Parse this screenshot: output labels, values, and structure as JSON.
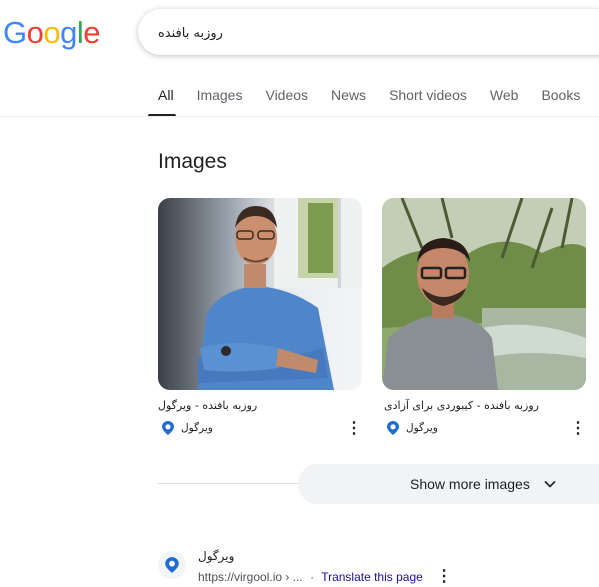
{
  "logo": {
    "letters": [
      "G",
      "o",
      "o",
      "g",
      "l",
      "e"
    ],
    "colors": [
      "#4285F4",
      "#EA4335",
      "#FBBC05",
      "#4285F4",
      "#34A853",
      "#EA4335"
    ]
  },
  "search": {
    "query": "روزبه بافنده"
  },
  "tabs": [
    {
      "label": "All",
      "active": true
    },
    {
      "label": "Images"
    },
    {
      "label": "Videos"
    },
    {
      "label": "News"
    },
    {
      "label": "Short videos"
    },
    {
      "label": "Web"
    },
    {
      "label": "Books"
    }
  ],
  "images_section": {
    "heading": "Images",
    "cards": [
      {
        "title": "روزبه بافنده - ویرگول",
        "source": "ویرگول",
        "source_icon": "virgool-icon"
      },
      {
        "title": "روزبه بافنده - کیبوردی برای آزادی",
        "source": "ویرگول",
        "source_icon": "virgool-icon"
      }
    ],
    "show_more_label": "Show more images"
  },
  "result": {
    "site_name": "ویرگول",
    "url": "https://virgool.io › ...",
    "separator": "·",
    "translate_label": "Translate this page"
  },
  "colors": {
    "accent_blue": "#1a0dab",
    "virgool_blue": "#1e6bd6"
  }
}
